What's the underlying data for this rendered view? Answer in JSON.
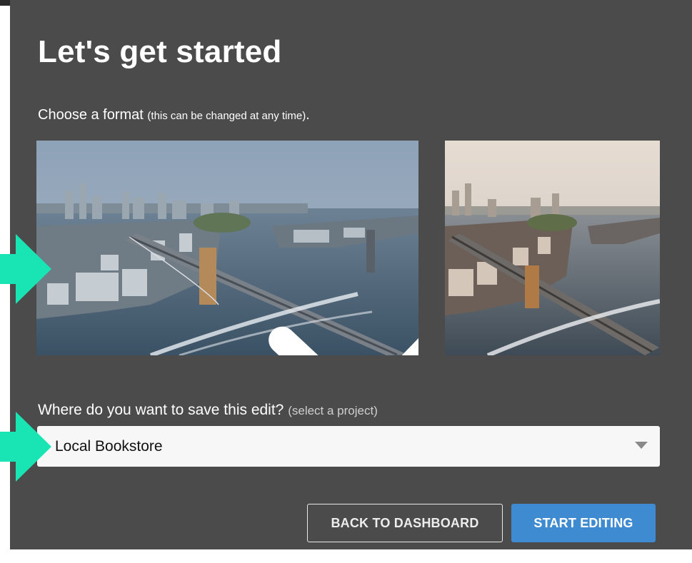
{
  "header": {
    "title": "Let's get started"
  },
  "format_section": {
    "label": "Choose a format",
    "hint": "(this can be changed at any time)",
    "trailing": ".",
    "options": [
      {
        "name": "landscape",
        "selected": true,
        "icon": "checkmark-icon"
      },
      {
        "name": "square",
        "selected": false
      }
    ]
  },
  "project_section": {
    "label": "Where do you want to save this edit?",
    "hint": "(select a project)",
    "selected_project": "Local Bookstore",
    "icon": "caret-down-icon"
  },
  "actions": {
    "back_label": "BACK TO DASHBOARD",
    "start_label": "START EDITING"
  },
  "colors": {
    "modal_bg": "#4b4b4b",
    "primary": "#3f8bd1",
    "annotation_arrow": "#19e5b4"
  }
}
